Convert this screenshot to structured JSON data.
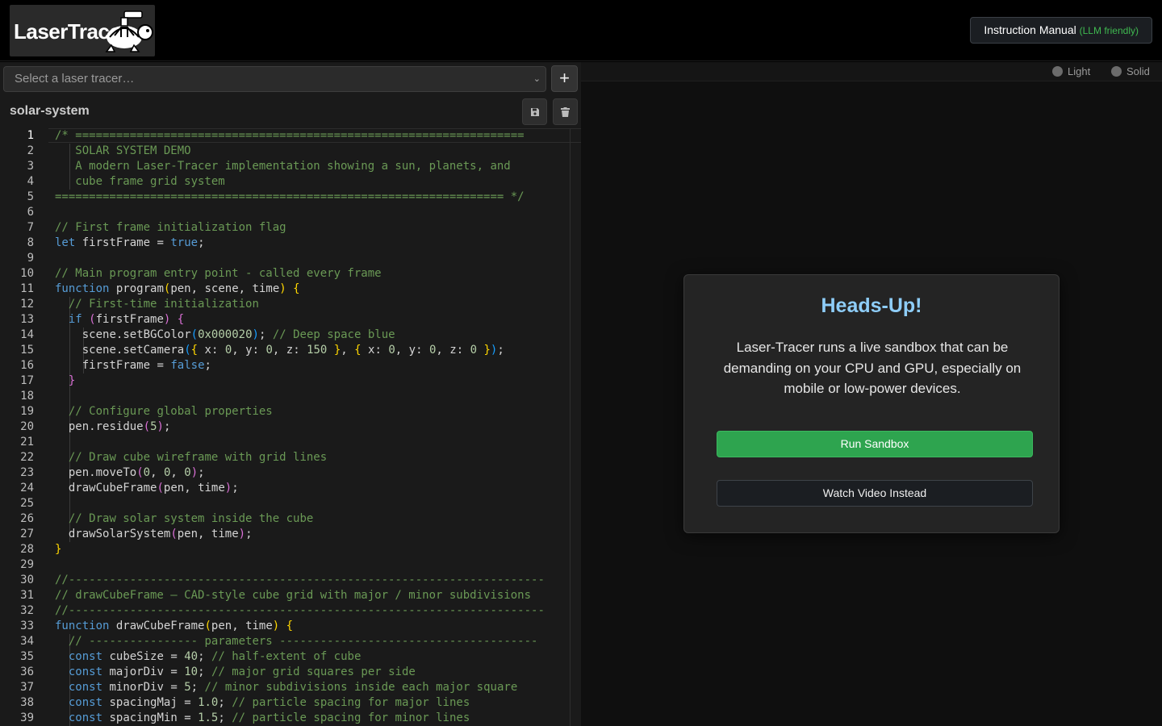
{
  "header": {
    "logo_text": "LaserTracer",
    "manual_label": "Instruction Manual",
    "manual_tag": "(LLM friendly)"
  },
  "left_panel": {
    "select_placeholder": "Select a laser tracer…",
    "add_label": "+",
    "file_name": "solar-system",
    "active_line": 1
  },
  "viewer": {
    "light_label": "Light",
    "solid_label": "Solid"
  },
  "modal": {
    "title": "Heads-Up!",
    "body": "Laser-Tracer runs a live sandbox that can be demanding on your CPU and GPU, especially on mobile or low-power devices.",
    "run_label": "Run Sandbox",
    "video_label": "Watch Video Instead"
  },
  "colors": {
    "accent_green": "#2ea44f",
    "title_blue": "#8ecdf8",
    "comment": "#6a9955",
    "keyword": "#569cd6"
  },
  "code_lines": [
    "/* ==================================================================",
    "   SOLAR SYSTEM DEMO",
    "   A modern Laser-Tracer implementation showing a sun, planets, and",
    "   cube frame grid system",
    "================================================================== */",
    "",
    "// First frame initialization flag",
    "let firstFrame = true;",
    "",
    "// Main program entry point - called every frame",
    "function program(pen, scene, time) {",
    "  // First-time initialization",
    "  if (firstFrame) {",
    "    scene.setBGColor(0x000020); // Deep space blue",
    "    scene.setCamera({ x: 0, y: 0, z: 150 }, { x: 0, y: 0, z: 0 });",
    "    firstFrame = false;",
    "  }",
    "",
    "  // Configure global properties",
    "  pen.residue(5);",
    "",
    "  // Draw cube wireframe with grid lines",
    "  pen.moveTo(0, 0, 0);",
    "  drawCubeFrame(pen, time);",
    "",
    "  // Draw solar system inside the cube",
    "  drawSolarSystem(pen, time);",
    "}",
    "",
    "//----------------------------------------------------------------------",
    "// drawCubeFrame – CAD-style cube grid with major / minor subdivisions",
    "//----------------------------------------------------------------------",
    "function drawCubeFrame(pen, time) {",
    "  // ---------------- parameters --------------------------------------",
    "  const cubeSize = 40; // half-extent of cube",
    "  const majorDiv = 10; // major grid squares per side",
    "  const minorDiv = 5; // minor subdivisions inside each major square",
    "  const spacingMaj = 1.0; // particle spacing for major lines",
    "  const spacingMin = 1.5; // particle spacing for minor lines"
  ]
}
